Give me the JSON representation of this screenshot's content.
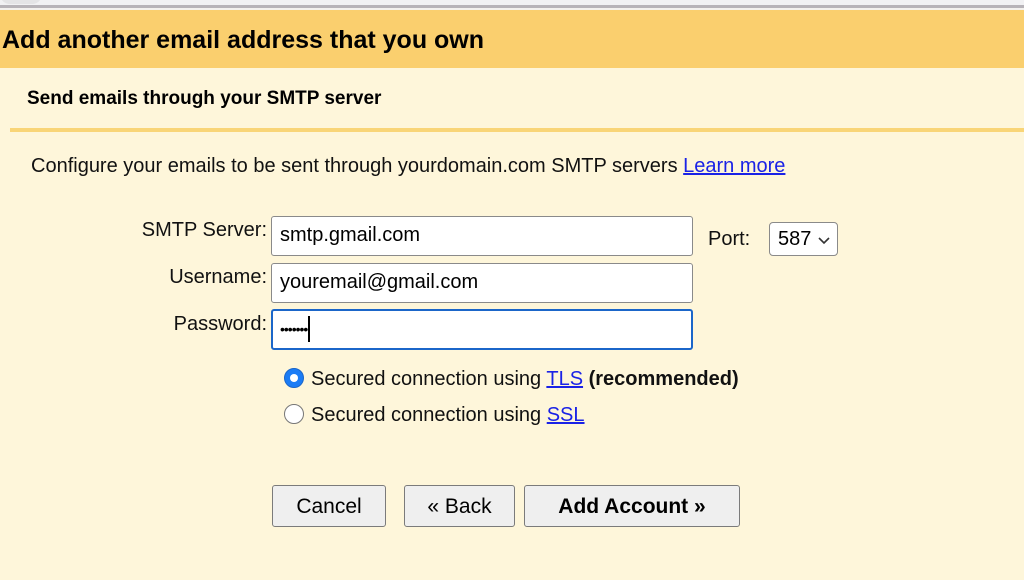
{
  "header": {
    "title": "Add another email address that you own"
  },
  "subheader": {
    "title": "Send emails through your SMTP server"
  },
  "description": {
    "text": "Configure your emails to be sent through yourdomain.com SMTP servers ",
    "link_label": "Learn more"
  },
  "form": {
    "smtp_server": {
      "label": "SMTP Server:",
      "value": "smtp.gmail.com"
    },
    "port": {
      "label": "Port:",
      "selected": "587"
    },
    "username": {
      "label": "Username:",
      "value": "youremail@gmail.com"
    },
    "password": {
      "label": "Password:",
      "masked_value": "•••••••"
    },
    "security_options": [
      {
        "prefix": "Secured connection using ",
        "link_label": "TLS",
        "suffix": "(recommended)",
        "checked": true
      },
      {
        "prefix": "Secured connection using ",
        "link_label": "SSL",
        "suffix": "",
        "checked": false
      }
    ]
  },
  "buttons": {
    "cancel": "Cancel",
    "back": "« Back",
    "add_account": "Add Account »"
  },
  "colors": {
    "header_bg": "#facf6e",
    "page_bg": "#fef6da",
    "link": "#1a22e6",
    "focus": "#1b66c9",
    "radio_checked": "#1b7cf5"
  }
}
